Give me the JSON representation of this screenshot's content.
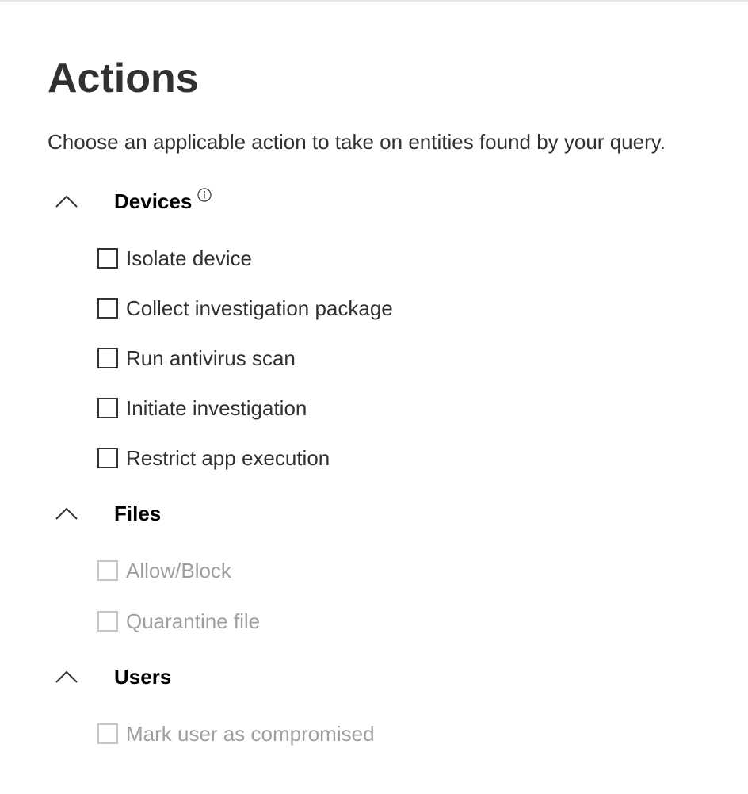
{
  "title": "Actions",
  "description": "Choose an applicable action to take on entities found by your query.",
  "groups": [
    {
      "label": "Devices",
      "has_info": true,
      "items": [
        {
          "label": "Isolate device",
          "checked": false,
          "disabled": false
        },
        {
          "label": "Collect investigation package",
          "checked": false,
          "disabled": false
        },
        {
          "label": "Run antivirus scan",
          "checked": false,
          "disabled": false
        },
        {
          "label": "Initiate investigation",
          "checked": false,
          "disabled": false
        },
        {
          "label": "Restrict app execution",
          "checked": false,
          "disabled": false
        }
      ]
    },
    {
      "label": "Files",
      "has_info": false,
      "items": [
        {
          "label": "Allow/Block",
          "checked": false,
          "disabled": true
        },
        {
          "label": "Quarantine file",
          "checked": false,
          "disabled": true
        }
      ]
    },
    {
      "label": "Users",
      "has_info": false,
      "items": [
        {
          "label": "Mark user as compromised",
          "checked": false,
          "disabled": true
        }
      ]
    }
  ],
  "icons": {
    "collapse": "chevron-up-icon",
    "info": "info-icon"
  },
  "colors": {
    "text": "#323130",
    "heading": "#000000",
    "disabled_text": "#a19f9d",
    "disabled_border": "#c8c6c4"
  }
}
